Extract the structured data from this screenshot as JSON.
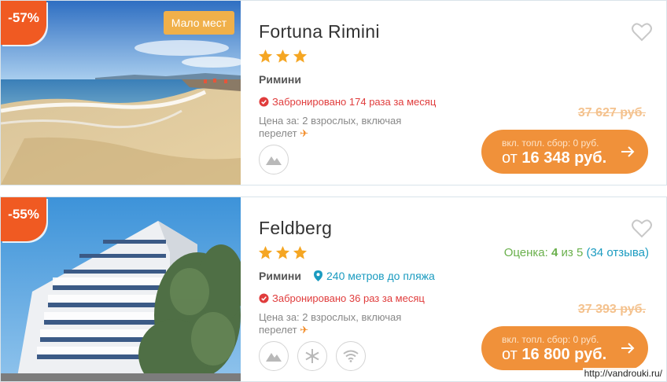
{
  "hotels": [
    {
      "discount": "-57%",
      "badge": "Мало мест",
      "name": "Fortuna Rimini",
      "stars": 3,
      "city": "Римини",
      "beach_distance": "",
      "booked": "Забронировано 174 раза за месяц",
      "price_for": "Цена за: 2 взрослых, включая перелет",
      "old_price": "37 627 руб.",
      "fee_note": "вкл. топл. сбор: 0 руб.",
      "price_prefix": "от",
      "price": "16 348 руб.",
      "amenities": [
        "mountain-icon"
      ],
      "rating": null,
      "photo": "beach"
    },
    {
      "discount": "-55%",
      "badge": "",
      "name": "Feldberg",
      "stars": 3,
      "city": "Римини",
      "beach_distance": "240 метров до пляжа",
      "booked": "Забронировано 36 раз за месяц",
      "price_for": "Цена за: 2 взрослых, включая перелет",
      "old_price": "37 393 руб.",
      "fee_note": "вкл. топл. сбор: 0 руб.",
      "price_prefix": "от",
      "price": "16 800 руб.",
      "amenities": [
        "mountain-icon",
        "snowflake-icon",
        "wifi-icon"
      ],
      "rating": {
        "label": "Оценка:",
        "score": "4",
        "of": "из 5",
        "reviews": "(34 отзыва)"
      },
      "photo": "building"
    }
  ],
  "watermark": "http://vandrouki.ru/",
  "colors": {
    "discount": "#f05a22",
    "cta": "#f0913a",
    "badge": "#f0b04a",
    "star": "#f5a623",
    "booked": "#e03c3c",
    "link": "#1a9bc0",
    "rating": "#6ab04c"
  }
}
